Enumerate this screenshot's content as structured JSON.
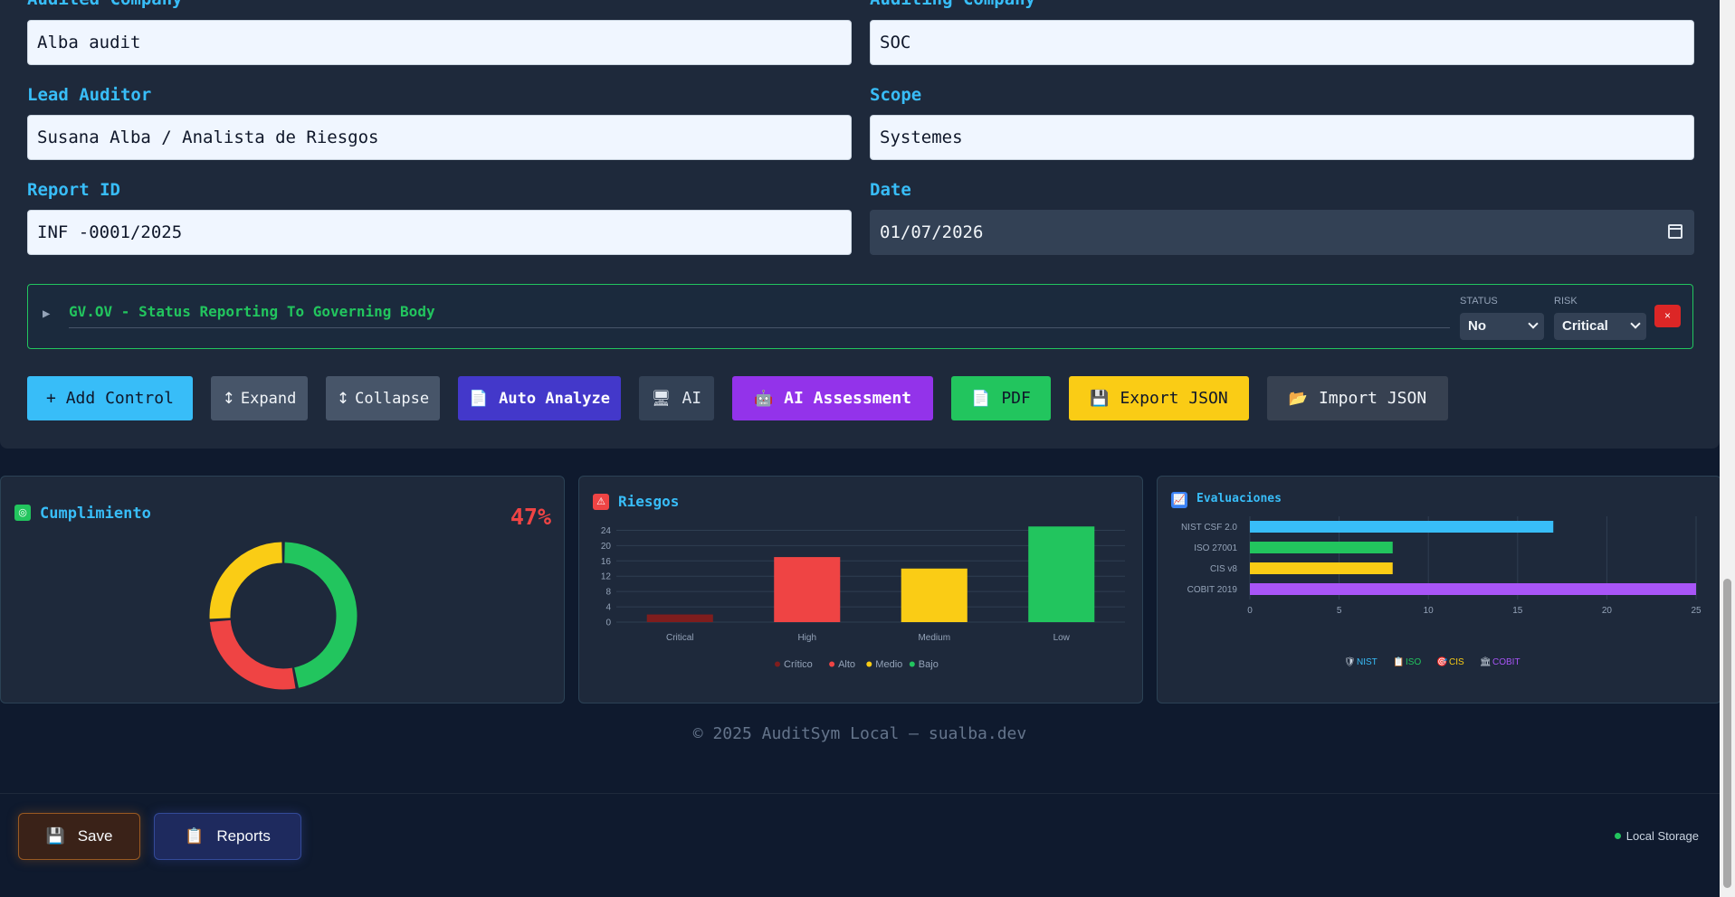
{
  "form": {
    "audited_company": {
      "label": "Audited Company",
      "value": "Alba audit"
    },
    "auditing_company": {
      "label": "Auditing Company",
      "value": "SOC"
    },
    "lead_auditor": {
      "label": "Lead Auditor",
      "value": "Susana Alba / Analista de Riesgos"
    },
    "scope": {
      "label": "Scope",
      "value": "Systemes"
    },
    "report_id": {
      "label": "Report ID",
      "value": "INF -0001/2025"
    },
    "date": {
      "label": "Date",
      "value": "01/07/2026"
    }
  },
  "control": {
    "title": "GV.OV - Status Reporting To Governing Body",
    "status_label": "STATUS",
    "status_value": "No",
    "risk_label": "RISK",
    "risk_value": "Critical",
    "delete_label": "×"
  },
  "toolbar": {
    "add_control": "+ Add Control",
    "expand": "Expand",
    "collapse": "Collapse",
    "auto_analyze": "Auto Analyze",
    "ai": "AI",
    "ai_assessment": "AI Assessment",
    "pdf": "PDF",
    "export_json": "Export JSON",
    "import_json": "Import JSON"
  },
  "cards": {
    "compliance": {
      "title": "Cumplimiento",
      "percent_text": "47%"
    },
    "risks": {
      "title": "Riesgos"
    },
    "assessments": {
      "title": "Evaluaciones"
    }
  },
  "chart_data": [
    {
      "type": "pie",
      "subtype": "doughnut",
      "values": [
        47,
        27,
        26
      ],
      "colors": [
        "#22c55e",
        "#ef4444",
        "#facc15"
      ]
    },
    {
      "type": "bar",
      "categories": [
        "Critical",
        "High",
        "Medium",
        "Low"
      ],
      "values": [
        2,
        17,
        14,
        25
      ],
      "colors": [
        "#7f1d1d",
        "#ef4444",
        "#facc15",
        "#22c55e"
      ],
      "ylim": [
        0,
        26
      ],
      "yticks": [
        0,
        4,
        8,
        12,
        16,
        20,
        24
      ],
      "legend": [
        "Crítico",
        "Alto",
        "Medio",
        "Bajo"
      ],
      "legend_position": "bottom",
      "grid": true
    },
    {
      "type": "bar",
      "orientation": "horizontal",
      "categories": [
        "NIST CSF 2.0",
        "ISO 27001",
        "CIS v8",
        "COBIT 2019"
      ],
      "values": [
        17,
        8,
        8,
        25
      ],
      "colors": [
        "#38bdf8",
        "#22c55e",
        "#facc15",
        "#a855f7"
      ],
      "xlim": [
        0,
        25
      ],
      "xticks": [
        0,
        5,
        10,
        15,
        20,
        25
      ],
      "legend": [
        "NIST",
        "ISO",
        "CIS",
        "COBIT"
      ],
      "legend_position": "bottom",
      "grid": true
    }
  ],
  "footer": {
    "text": "© 2025 AuditSym Local — sualba.dev"
  },
  "bottom": {
    "save": "Save",
    "reports": "Reports",
    "storage": "Local Storage"
  }
}
